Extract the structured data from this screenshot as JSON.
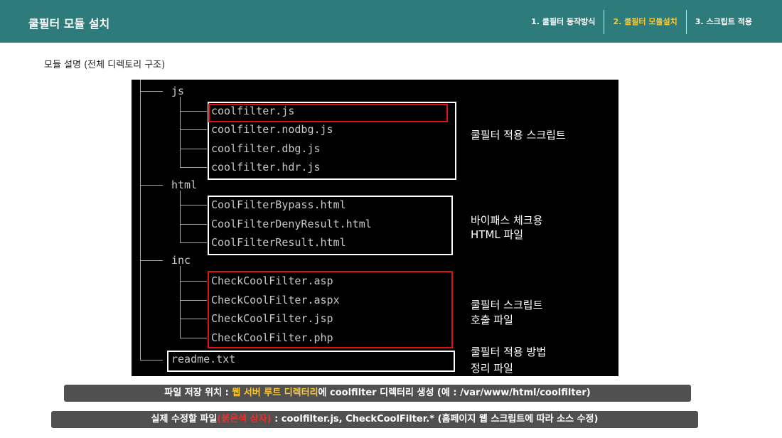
{
  "header": {
    "title": "쿨필터 모듈 설치",
    "steps": [
      {
        "label": "1. 쿨필터 동작방식",
        "active": false
      },
      {
        "label": "2. 쿨필터 모듈설치",
        "active": true
      },
      {
        "label": "3. 스크립트 적용",
        "active": false
      }
    ]
  },
  "subtitle": "모듈 설명 (전체 디렉토리 구조)",
  "tree": {
    "dirs": [
      "js",
      "html",
      "inc"
    ],
    "js_files": [
      "coolfilter.js",
      "coolfilter.nodbg.js",
      "coolfilter.dbg.js",
      "coolfilter.hdr.js"
    ],
    "html_files": [
      "CoolFilterBypass.html",
      "CoolFilterDenyResult.html",
      "CoolFilterResult.html"
    ],
    "inc_files": [
      "CheckCoolFilter.asp",
      "CheckCoolFilter.aspx",
      "CheckCoolFilter.jsp",
      "CheckCoolFilter.php"
    ],
    "readme": "readme.txt"
  },
  "descriptions": {
    "js": "쿨필터 적용 스크립트",
    "html_line1": "바이패스 체크용",
    "html_line2": "HTML 파일",
    "inc_line1": "쿨필터 스크립트",
    "inc_line2": "호출 파일",
    "readme_line1": "쿨필터 적용 방법",
    "readme_line2": "정리 파일"
  },
  "banners": {
    "b1_prefix": "파일 저장 위치 : ",
    "b1_highlight": "웹 서버 루트 디렉터리",
    "b1_suffix": "에 coolfilter 디렉터리 생성 (예 : /var/www/html/coolfilter)",
    "b2_prefix": "실제 수정할 파일",
    "b2_highlight": "(붉은색 상자)",
    "b2_suffix": " : coolfilter.js, CheckCoolFilter.* (홈페이지 웹 스크립트에 따라 소스 수정)"
  },
  "colors": {
    "header_bg": "#2e7b7c",
    "active_step": "#ffc72c",
    "banner_bg": "#505050",
    "red_box": "#e01010",
    "highlight_red": "#e8302a"
  }
}
